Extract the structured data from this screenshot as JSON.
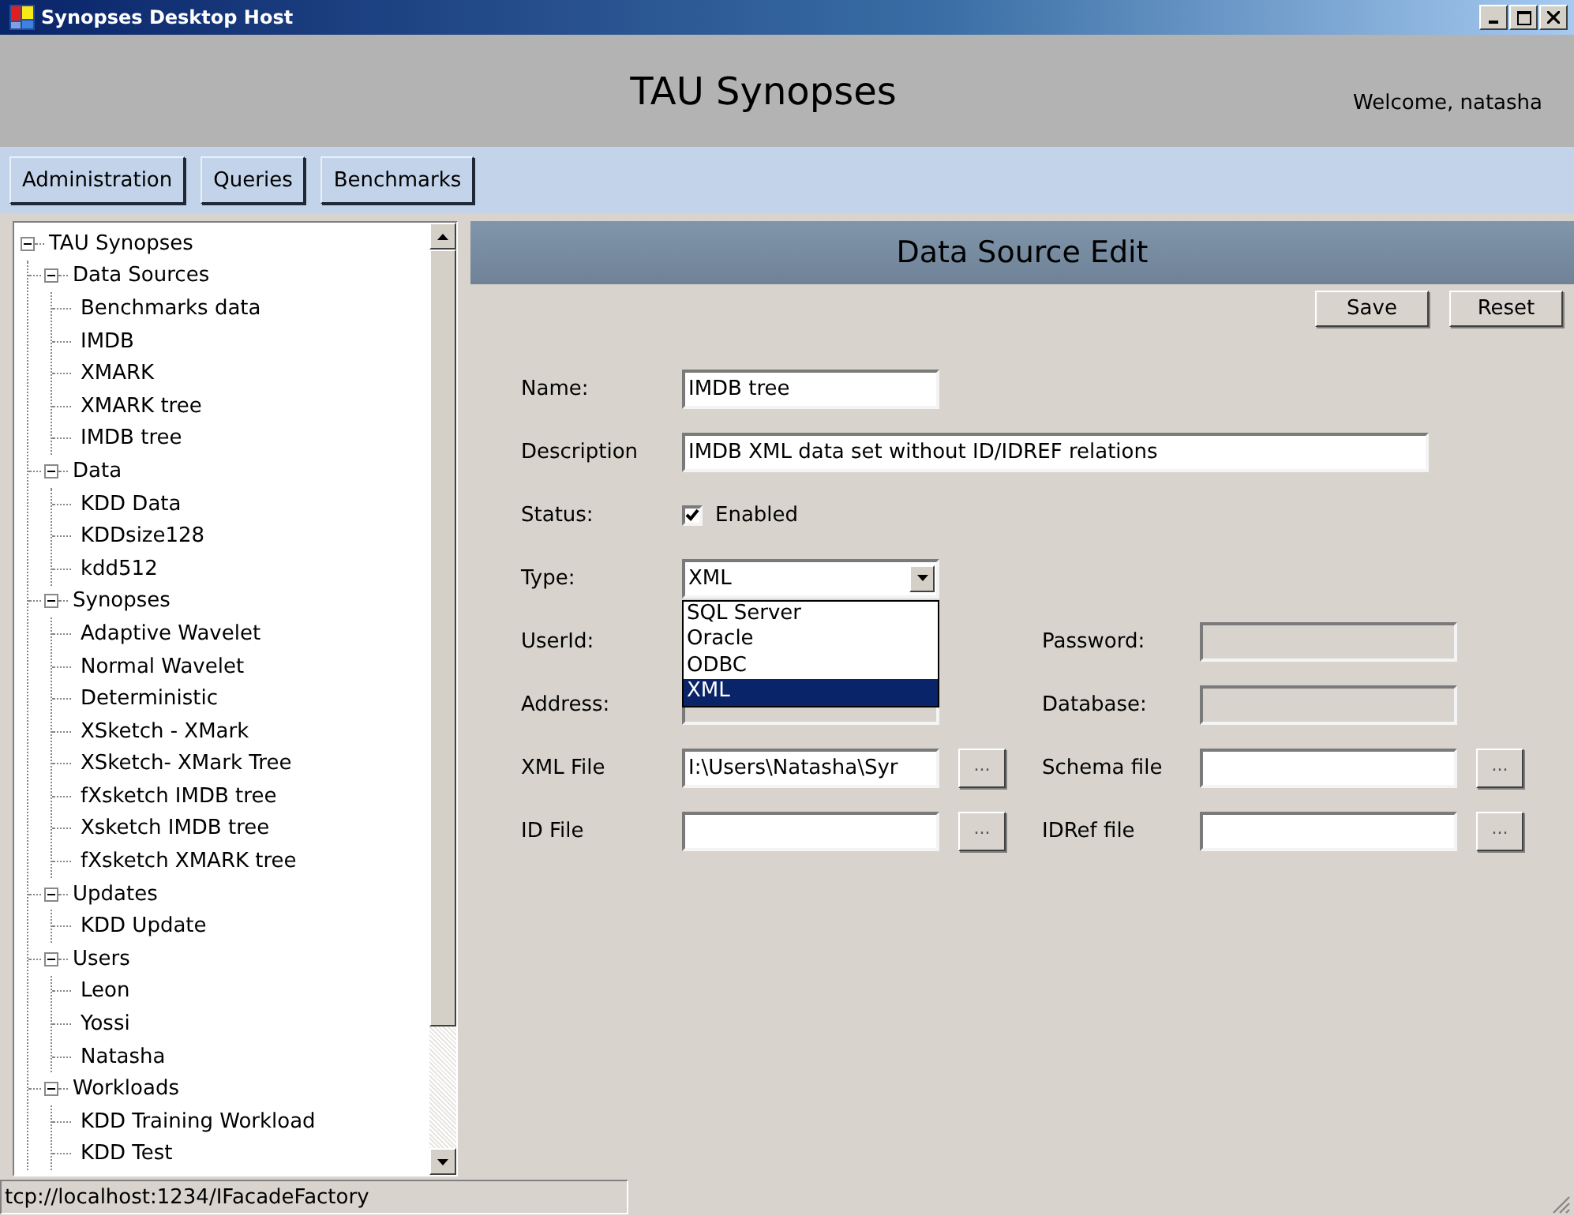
{
  "window": {
    "title": "Synopses Desktop Host"
  },
  "header": {
    "title": "TAU Synopses",
    "welcome": "Welcome, natasha"
  },
  "nav": [
    {
      "label": "Administration"
    },
    {
      "label": "Queries"
    },
    {
      "label": "Benchmarks"
    }
  ],
  "tree": {
    "label": "TAU Synopses",
    "expanded": true,
    "children": [
      {
        "label": "Data Sources",
        "expanded": true,
        "children": [
          {
            "label": "Benchmarks data"
          },
          {
            "label": "IMDB"
          },
          {
            "label": "XMARK"
          },
          {
            "label": "XMARK tree"
          },
          {
            "label": "IMDB tree"
          }
        ]
      },
      {
        "label": "Data",
        "expanded": true,
        "children": [
          {
            "label": "KDD Data"
          },
          {
            "label": "KDDsize128"
          },
          {
            "label": "kdd512"
          }
        ]
      },
      {
        "label": "Synopses",
        "expanded": true,
        "children": [
          {
            "label": "Adaptive Wavelet"
          },
          {
            "label": "Normal Wavelet"
          },
          {
            "label": "Deterministic"
          },
          {
            "label": "XSketch - XMark"
          },
          {
            "label": "XSketch- XMark Tree"
          },
          {
            "label": "fXsketch IMDB tree"
          },
          {
            "label": "Xsketch IMDB tree"
          },
          {
            "label": "fXsketch XMARK tree"
          }
        ]
      },
      {
        "label": "Updates",
        "expanded": true,
        "children": [
          {
            "label": "KDD Update"
          }
        ]
      },
      {
        "label": "Users",
        "expanded": true,
        "children": [
          {
            "label": "Leon"
          },
          {
            "label": "Yossi"
          },
          {
            "label": "Natasha"
          }
        ]
      },
      {
        "label": "Workloads",
        "expanded": true,
        "children": [
          {
            "label": "KDD Training Workload"
          },
          {
            "label": "KDD Test"
          }
        ]
      }
    ]
  },
  "panel": {
    "title": "Data Source Edit",
    "buttons": [
      {
        "label": "Save"
      },
      {
        "label": "Reset"
      }
    ],
    "rows": [
      {
        "left": {
          "kind": "text",
          "label": "Name:",
          "value": "IMDB tree",
          "disabled": false
        }
      },
      {
        "left": {
          "kind": "longtext",
          "label": "Description",
          "value": "IMDB XML data set without ID/IDREF relations",
          "disabled": false
        }
      },
      {
        "left": {
          "kind": "checkbox",
          "label": "Status:",
          "text": "Enabled",
          "checked": true
        }
      },
      {
        "left": {
          "kind": "select",
          "label": "Type:",
          "value": "XML",
          "open": true,
          "options": [
            {
              "label": "SQL Server",
              "selected": false
            },
            {
              "label": "Oracle",
              "selected": false
            },
            {
              "label": "ODBC",
              "selected": false
            },
            {
              "label": "XML",
              "selected": true
            }
          ]
        }
      },
      {
        "left": {
          "kind": "label",
          "label": "UserId:"
        },
        "right": {
          "kind": "text",
          "label": "Password:",
          "disabled": true
        }
      },
      {
        "left": {
          "kind": "text",
          "label": "Address:",
          "disabled": true
        },
        "right": {
          "kind": "text",
          "label": "Database:",
          "disabled": true
        }
      },
      {
        "left": {
          "kind": "file",
          "label": "XML File",
          "value": "I:\\Users\\Natasha\\Syr",
          "browse": "...",
          "disabled": false
        },
        "right": {
          "kind": "file",
          "label": "Schema file",
          "browse": "...",
          "disabled": false
        }
      },
      {
        "left": {
          "kind": "file",
          "label": "ID File",
          "browse": "...",
          "disabled": false
        },
        "right": {
          "kind": "file",
          "label": "IDRef file",
          "browse": "...",
          "disabled": false
        }
      }
    ]
  },
  "status_bar": {
    "text": "tcp://localhost:1234/IFacadeFactory"
  }
}
